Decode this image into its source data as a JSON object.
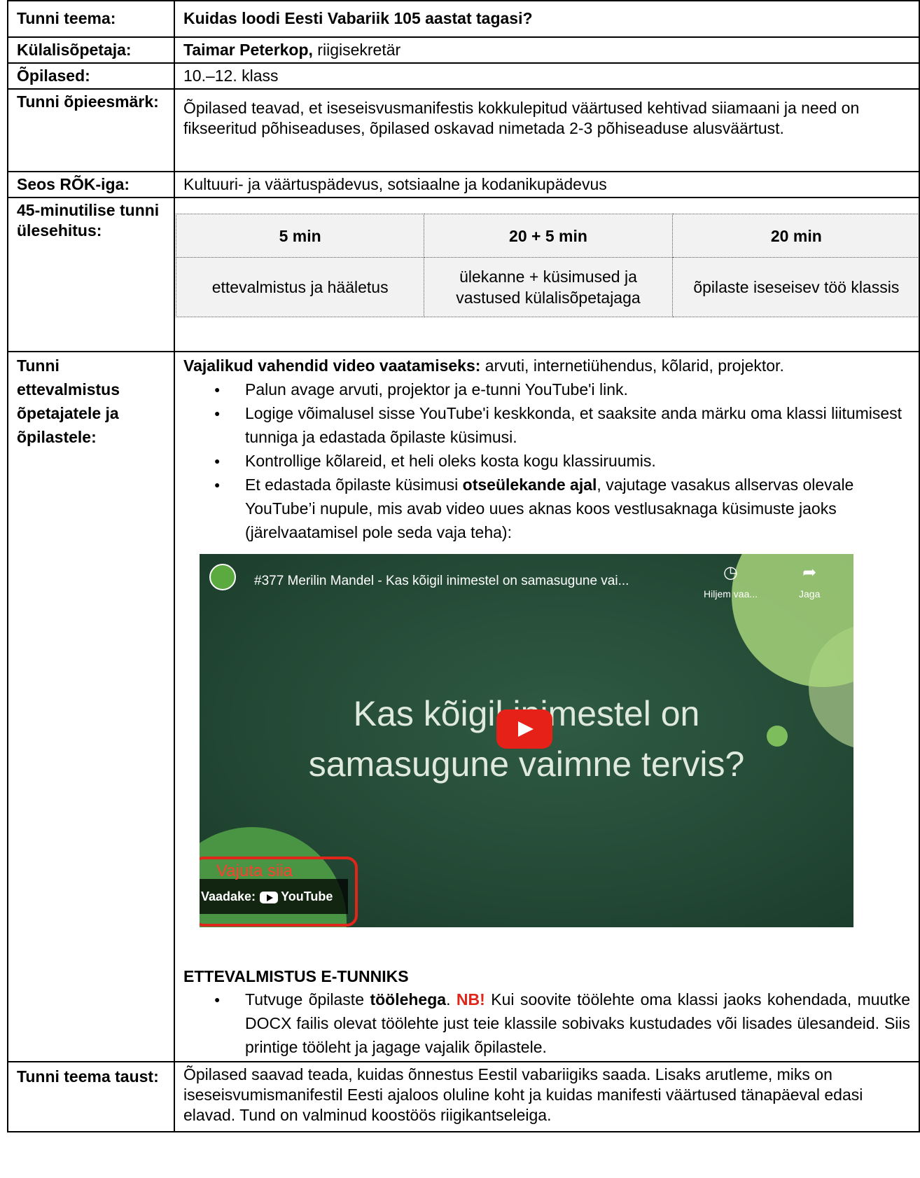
{
  "rows": {
    "teema": {
      "label": "Tunni teema:",
      "value": "Kuidas loodi Eesti Vabariik 105 aastat tagasi?"
    },
    "kulalisopetaja": {
      "label": "Külalisõpetaja:",
      "name": "Taimar Peterkop,",
      "role": " riigisekretär"
    },
    "opilased": {
      "label": "Õpilased:",
      "value": "10.–12. klass"
    },
    "eesmark": {
      "label": "Tunni õpieesmärk:",
      "value": "Õpilased teavad, et iseseisvusmanifestis kokkulepitud väärtused kehtivad siiamaani ja need on fikseeritud põhiseaduses, õpilased oskavad nimetada 2-3 põhiseaduse alusväärtust."
    },
    "seos": {
      "label": "Seos RÕK-iga:",
      "value": "Kultuuri- ja väärtuspädevus, sotsiaalne ja kodanikupädevus"
    },
    "ulesehitus": {
      "label": "45-minutilise tunni ülesehitus:",
      "headers": [
        "5 min",
        "20 + 5 min",
        "20 min"
      ],
      "cells": [
        "ettevalmistus ja hääletus",
        "ülekanne + küsimused ja vastused külalisõpetajaga",
        "õpilaste iseseisev töö klassis"
      ]
    },
    "ettevalmistus": {
      "label": "Tunni ettevalmistus õpetajatele ja õpilastele:",
      "intro_bold": "Vajalikud vahendid video vaatamiseks:",
      "intro_rest": " arvuti, internetiühendus, kõlarid, projektor.",
      "bullets": [
        "Palun avage arvuti, projektor ja e-tunni YouTube'i link.",
        "Logige võimalusel sisse YouTube'i keskkonda, et saaksite anda märku oma klassi liitumisest tunniga ja edastada õpilaste küsimusi.",
        "Kontrollige kõlareid, et heli oleks kosta kogu klassiruumis."
      ],
      "bullet4_a": "Et edastada õpilaste küsimusi ",
      "bullet4_bold": "otseülekande ajal",
      "bullet4_b": ", vajutage vasakus allservas olevale YouTube’i nupule, mis avab video uues aknas koos vestlusaknaga küsimuste jaoks (järelvaatamisel pole seda vaja teha):",
      "video": {
        "title": "#377 Merilin Mandel - Kas kõigil inimestel on samasugune vai...",
        "watch_later": "Hiljem vaa...",
        "share": "Jaga",
        "line1": "Kas kõigil inimestel on",
        "line2": "samasugune vaimne tervis?",
        "watch_on": "Vaadake:",
        "youtube": "YouTube",
        "annotation": "Vajuta siia"
      },
      "e_heading": "ETTEVALMISTUS E-TUNNIKS",
      "e_a": "Tutvuge õpilaste ",
      "e_bold": "töölehega",
      "e_b": ". ",
      "e_nb": "NB!",
      "e_c": " Kui soovite töölehte oma klassi jaoks kohendada, muutke DOCX failis olevat töölehte just teie klassile sobivaks kustudades või lisades ülesandeid. Siis printige tööleht ja jagage vajalik õpilastele."
    },
    "taust": {
      "label": "Tunni teema taust:",
      "value": "Õpilased saavad teada, kuidas õnnestus Eestil vabariigiks saada. Lisaks arutleme, miks on iseseisvumismanifestil Eesti ajaloos oluline koht ja kuidas manifesti väärtused tänapäeval edasi elavad.  Tund on valminud koostöös riigikantseleiga."
    }
  },
  "colors": {
    "accent_red": "#e0251b",
    "youtube_red": "#e62117"
  }
}
